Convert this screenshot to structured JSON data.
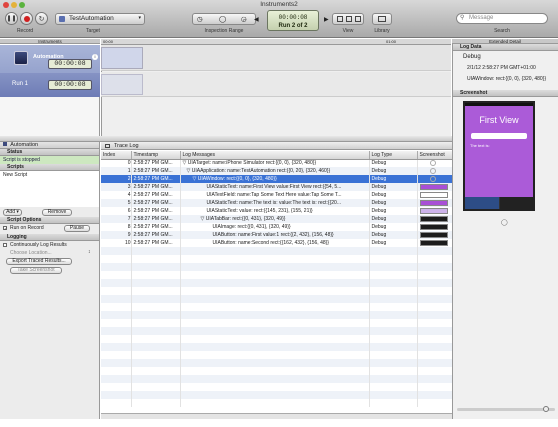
{
  "window": {
    "title": "Instruments2"
  },
  "toolbar": {
    "record_label": "Record",
    "target_label": "Target",
    "target_value": "TestAutomation",
    "inspection_label": "Inspection Range",
    "lcd_time": "00:00:08",
    "lcd_run": "Run 2 of 2",
    "view_label": "View",
    "library_label": "Library",
    "search_placeholder": "Message",
    "search_label": "Search"
  },
  "instruments": {
    "header": "Instruments",
    "items": [
      {
        "name": "Automation",
        "time": "00:00:08"
      }
    ],
    "run_label": "Run 1",
    "run_time": "00:00:08"
  },
  "ruler": {
    "start": "00:00",
    "end": "01:00"
  },
  "left_panel": {
    "instrument": "Automation",
    "status_header": "Status",
    "status_text": "Script is stopped",
    "scripts_header": "Scripts",
    "script_name": "New Script",
    "add_label": "Add",
    "remove_label": "Remove",
    "options_header": "Script Options",
    "run_on_record": "Run on Record",
    "pause_label": "Pause",
    "logging_header": "Logging",
    "continuously": "Continuously Log Results",
    "choose_location": "Choose Location...",
    "export_label": "Export Traced Results...",
    "screenshot_label": "Take Screenshot"
  },
  "log_table": {
    "view_name": "Trace Log",
    "columns": [
      "Index",
      "Timestamp",
      "Log Messages",
      "Log Type",
      "Screenshot"
    ],
    "rows": [
      {
        "index": "0",
        "time": "2:58:27 PM GM...",
        "msg": "▽ UIATarget: name:iPhone Simulator rect:{{0, 0}, {320, 480}}",
        "type": "Debug",
        "thumb": "none"
      },
      {
        "index": "1",
        "time": "2:58:27 PM GM...",
        "msg": "▽ UIAApplication: name:TestAutomation rect:{{0, 20}, {320, 460}}",
        "type": "Debug",
        "thumb": "none"
      },
      {
        "index": "2",
        "time": "2:58:27 PM GM...",
        "msg": "▽ UIAWindow: rect:{{0, 0}, {320, 480}}",
        "type": "Debug",
        "thumb": "none"
      },
      {
        "index": "3",
        "time": "2:58:27 PM GM...",
        "msg": "UIAStaticText: name:First View value:First View rect:{{54, 5...",
        "type": "Debug",
        "thumb": "purple"
      },
      {
        "index": "4",
        "time": "2:58:27 PM GM...",
        "msg": "UIATextField: name:Tap Some Text Here value:Tap Some T...",
        "type": "Debug",
        "thumb": "white"
      },
      {
        "index": "5",
        "time": "2:58:27 PM GM...",
        "msg": "UIAStaticText: name:The text is: value:The text is: rect:{{20...",
        "type": "Debug",
        "thumb": "purple"
      },
      {
        "index": "6",
        "time": "2:58:27 PM GM...",
        "msg": "UIAStaticText: value: rect:{{145, 231}, {155, 21}}",
        "type": "Debug",
        "thumb": "lavender"
      },
      {
        "index": "7",
        "time": "2:58:27 PM GM...",
        "msg": "▽ UIATabBar: rect:{{0, 431}, {320, 49}}",
        "type": "Debug",
        "thumb": "dark"
      },
      {
        "index": "8",
        "time": "2:58:27 PM GM...",
        "msg": "UIAImage: rect:{{0, 431}, {320, 49}}",
        "type": "Debug",
        "thumb": "dark"
      },
      {
        "index": "9",
        "time": "2:58:27 PM GM...",
        "msg": "UIAButton: name:First value:1 rect:{{2, 432}, {156, 48}}",
        "type": "Debug",
        "thumb": "dark"
      },
      {
        "index": "10",
        "time": "2:58:27 PM GM...",
        "msg": "UIAButton: name:Second rect:{{162, 432}, {156, 48}}",
        "type": "Debug",
        "thumb": "dark"
      }
    ],
    "selected_index": "2"
  },
  "extended": {
    "header": "Extended Detail",
    "log_data_header": "Log Data",
    "log_type": "Debug",
    "log_time": "2/1/12 2:58:27 PM GMT+01:00",
    "log_message": "UIAWindow: rect:{{0, 0}, {320, 480}}",
    "screenshot_header": "Screenshot",
    "phone_title": "First View",
    "phone_text": "The text is:"
  },
  "colors": {
    "selection": "#3a72d5",
    "instrument_row": "#8593c4",
    "record_red": "#d11f1f"
  }
}
